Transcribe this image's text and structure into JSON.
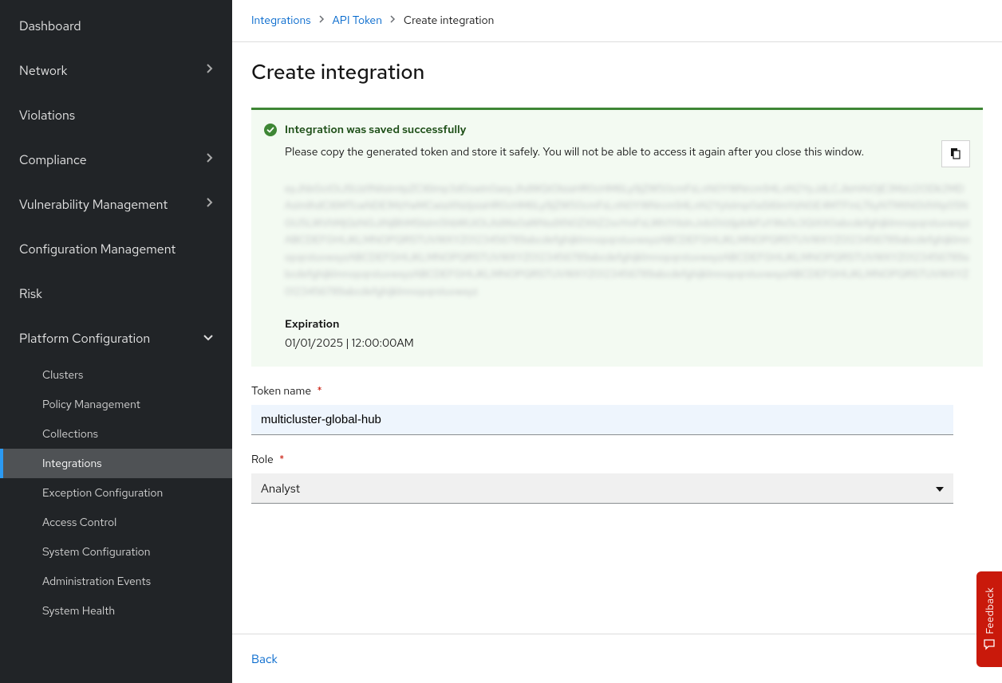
{
  "sidebar": {
    "items": [
      {
        "label": "Dashboard",
        "has_children": false
      },
      {
        "label": "Network",
        "has_children": true
      },
      {
        "label": "Violations",
        "has_children": false
      },
      {
        "label": "Compliance",
        "has_children": true
      },
      {
        "label": "Vulnerability Management",
        "has_children": true
      },
      {
        "label": "Configuration Management",
        "has_children": false
      },
      {
        "label": "Risk",
        "has_children": false
      },
      {
        "label": "Platform Configuration",
        "has_children": true,
        "expanded": true
      }
    ],
    "platform_sub": [
      {
        "label": "Clusters"
      },
      {
        "label": "Policy Management"
      },
      {
        "label": "Collections"
      },
      {
        "label": "Integrations",
        "active": true
      },
      {
        "label": "Exception Configuration"
      },
      {
        "label": "Access Control"
      },
      {
        "label": "System Configuration"
      },
      {
        "label": "Administration Events"
      },
      {
        "label": "System Health"
      }
    ]
  },
  "breadcrumb": {
    "first": "Integrations",
    "second": "API Token",
    "current": "Create integration"
  },
  "page": {
    "title": "Create integration"
  },
  "alert": {
    "title": "Integration was saved successfully",
    "desc": "Please copy the generated token and store it safely. You will not be able to access it again after you close this window.",
    "token_blur": "eyJhbGciOiJSUzI1NiIsImtpZCI6Imp3dGswIn0aeyJhdWQiOlsiaHR0cHM6Ly9jZW50cmFsLnN0YWNrcm94LnN2YyJdLCJleHAiOjE3MzU2ODk2MDAsImlhdCI6MTcwNDE1MzYwMCwiaXNzIjoiaHR0cHM6Ly9jZW50cmFsLnN0YWNrcm94LnN2YyIsImp0aSI6ImYzNGE4MTFmLTkyNTMtNGVhNy05NGU5LWVhMjQzNGJiNjBhMSIsIm5hbWUiOiJtdWx0aWNsdXN0ZXItZ2xvYmFsLWh1YiIsInJvbGVzIjpbIkFuYWx5c3QiXX0abcdefghijklmnopqrstuvwxyzABCDEFGHIJKLMNOPQRSTUVWXYZ0123456789abcdefghijklmnopqrstuvwxyzABCDEFGHIJKLMNOPQRSTUVWXYZ0123456789abcdefghijklmnopqrstuvwxyzABCDEFGHIJKLMNOPQRSTUVWXYZ0123456789abcdefghijklmnopqrstuvwxyzABCDEFGHIJKLMNOPQRSTUVWXYZ0123456789abcdefghijklmnopqrstuvwxyzABCDEFGHIJKLMNOPQRSTUVWXYZ0123456789abcdefghijklmnopqrstuvwxyzABCDEFGHIJKLMNOPQRSTUVWXYZ0123456789abcdefghijklmnopqrstuvwxyz",
    "expiration_label": "Expiration",
    "expiration_value": "01/01/2025 | 12:00:00AM"
  },
  "form": {
    "token_name_label": "Token name",
    "token_name_value": "multicluster-global-hub",
    "role_label": "Role",
    "role_value": "Analyst",
    "required_mark": "*"
  },
  "footer": {
    "back_label": "Back"
  },
  "feedback": {
    "label": "Feedback"
  }
}
